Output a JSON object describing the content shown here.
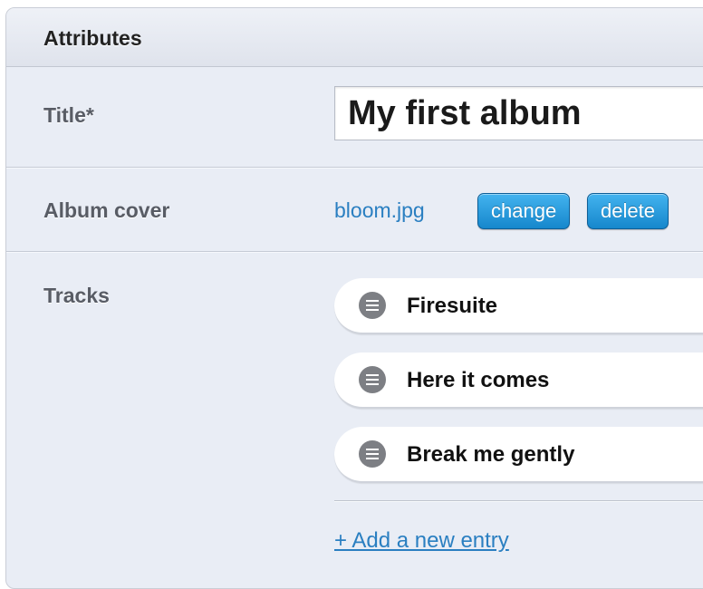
{
  "panel": {
    "title": "Attributes"
  },
  "fields": {
    "title": {
      "label": "Title*",
      "value": "My first album"
    },
    "album_cover": {
      "label": "Album cover",
      "file_name": "bloom.jpg",
      "change_label": "change",
      "delete_label": "delete"
    },
    "tracks": {
      "label": "Tracks",
      "items": [
        {
          "name": "Firesuite",
          "icon": "drag-handle-icon"
        },
        {
          "name": "Here it comes",
          "icon": "drag-handle-icon"
        },
        {
          "name": "Break me gently",
          "icon": "drag-handle-icon"
        }
      ],
      "add_label": "+ Add a new entry"
    }
  },
  "colors": {
    "panel_background": "#e9edf5",
    "link": "#2a7fc1",
    "button_blue": "#1e95dc",
    "handle_gray": "#7d7f84"
  }
}
